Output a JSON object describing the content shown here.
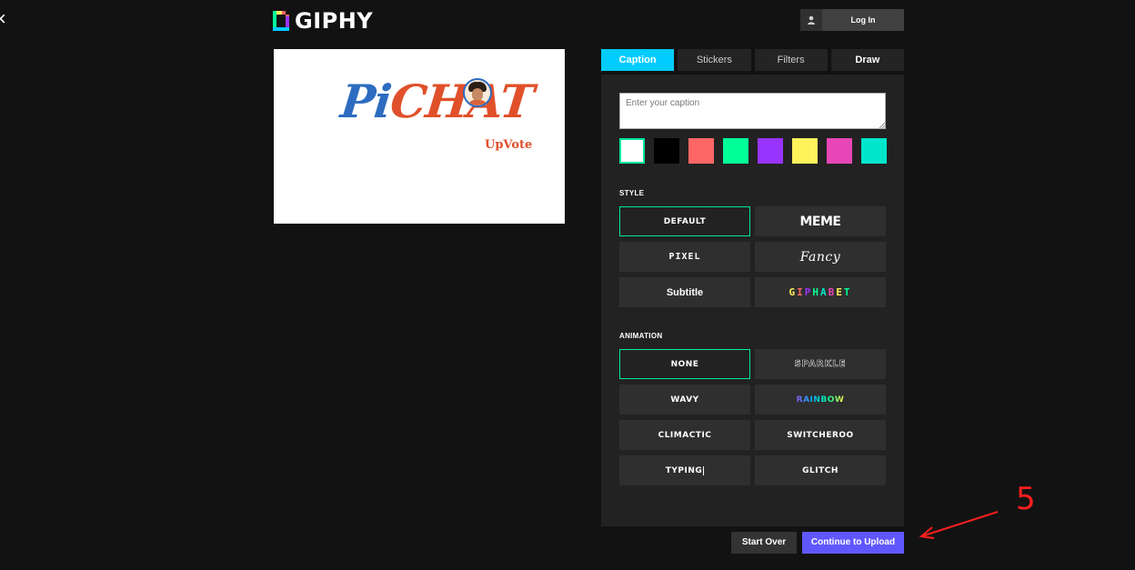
{
  "header": {
    "logo_text": "GIPHY",
    "login_label": "Log In"
  },
  "preview": {
    "title_part1": "Pi",
    "title_part2": "CHAT",
    "subtitle": "UpVote"
  },
  "tabs": [
    {
      "label": "Caption",
      "active": true
    },
    {
      "label": "Stickers"
    },
    {
      "label": "Filters"
    },
    {
      "label": "Draw"
    }
  ],
  "caption": {
    "placeholder": "Enter your caption",
    "value": ""
  },
  "swatches": [
    "#ffffff",
    "#000000",
    "#ff6666",
    "#00ff99",
    "#9933ff",
    "#fff35c",
    "#e646b6",
    "#00e6cc"
  ],
  "selected_swatch": "#ffffff",
  "style": {
    "heading": "STYLE",
    "options": [
      "DEFAULT",
      "MEME",
      "PIXEL",
      "Fancy",
      "Subtitle",
      "GIPHABET"
    ],
    "selected": "DEFAULT"
  },
  "animation": {
    "heading": "ANIMATION",
    "options": [
      "NONE",
      "SPARKLE",
      "WAVY",
      "RAINBOW",
      "CLIMACTIC",
      "SWITCHEROO",
      "TYPING",
      "GLITCH"
    ],
    "selected": "NONE"
  },
  "footer": {
    "start_over_label": "Start Over",
    "continue_label": "Continue to Upload"
  },
  "annotation": {
    "number": "5",
    "color": "#ff1f1f"
  },
  "colors": {
    "accent_tab": "#00ccff",
    "accent_select": "#00e6a0",
    "primary_button": "#6157ff"
  }
}
